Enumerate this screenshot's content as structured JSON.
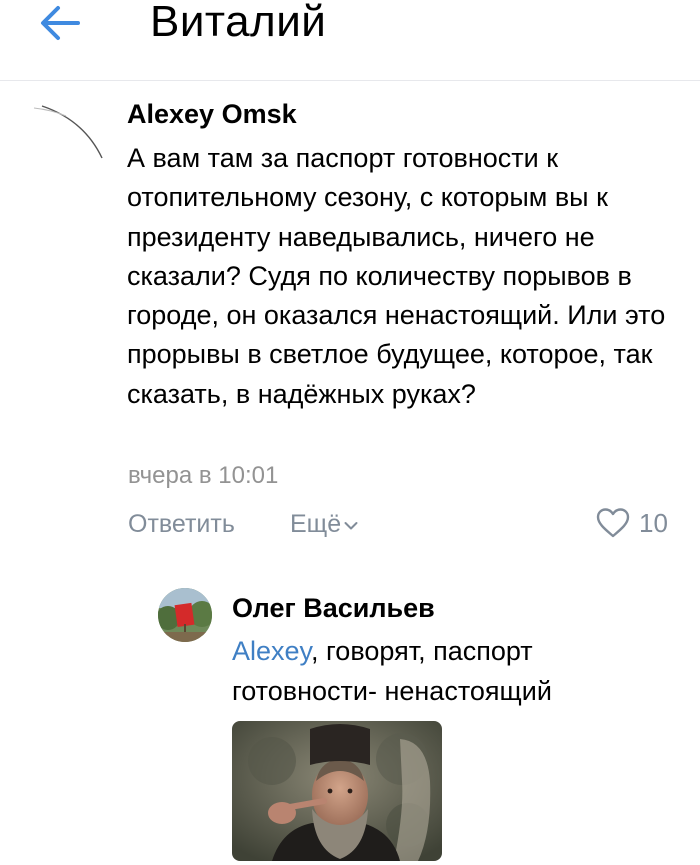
{
  "header": {
    "title": "Виталий",
    "back_icon": "arrow-left-icon",
    "accent_color": "#3f8ae0"
  },
  "comment": {
    "author": "Alexey Omsk",
    "text": "А вам там за паспорт готовности к отопительному сезону, с которым вы к президенту наведывались, ничего не сказали? Судя по количеству порывов в городе, он оказался ненастоящий. Или это прорывы в светлое будущее, которое, так сказать, в надёжных руках?",
    "timestamp": "вчера в 10:01",
    "reply_label": "Ответить",
    "more_label": "Ещё",
    "more_icon": "chevron-down-icon",
    "like_icon": "heart-icon",
    "likes": "10"
  },
  "reply": {
    "author": "Олег Васильев",
    "mention": "Alexey",
    "text": ", говорят, паспорт готовности- ненастоящий",
    "mention_color": "#3f7fc4"
  },
  "colors": {
    "secondary_text": "#818c99",
    "timestamp": "#939393",
    "divider": "#e7e8ec"
  }
}
